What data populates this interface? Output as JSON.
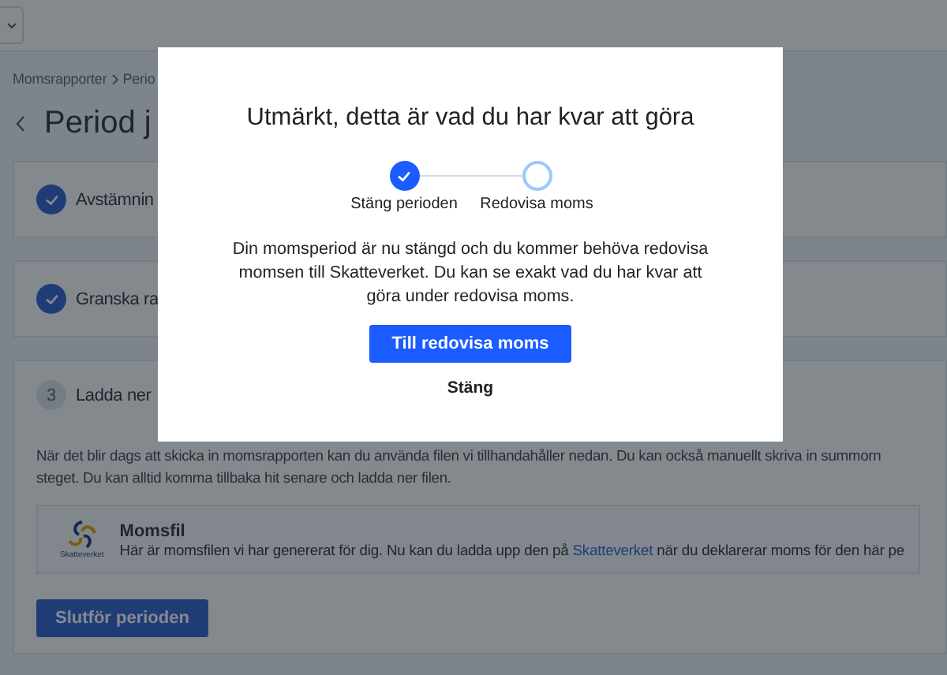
{
  "breadcrumb": [
    "Momsrapporter",
    "Perio"
  ],
  "page_title": "Period j",
  "steps": [
    {
      "label": "Avstämnin",
      "completed": true
    },
    {
      "label": "Granska ra",
      "completed": true
    },
    {
      "label": "Ladda ner",
      "completed": false,
      "number": "3",
      "description": [
        "När det blir dags att skicka in momsrapporten kan du använda filen vi tillhandahåller nedan. Du kan också manuellt skriva in summorn",
        "steget. Du kan alltid komma tillbaka hit senare och ladda ner filen."
      ],
      "file": {
        "logo_text": "Skatteverket",
        "title": "Momsfil",
        "text_before": "Här är momsfilen vi har genererat för dig. Nu kan du ladda upp den på ",
        "link": "Skatteverket",
        "text_after": " när du deklarerar moms för den här pe"
      },
      "button": "Slutför perioden"
    }
  ],
  "modal": {
    "title": "Utmärkt, detta är vad du har kvar att göra",
    "progress": [
      {
        "label": "Stäng perioden",
        "completed": true
      },
      {
        "label": "Redovisa moms",
        "completed": false
      }
    ],
    "message": "Din momsperiod är nu stängd och du kommer behöva redovisa momsen till Skatteverket. Du kan se exakt vad du har kvar att göra under redovisa moms.",
    "primary_button": "Till redovisa moms",
    "close_button": "Stäng"
  }
}
